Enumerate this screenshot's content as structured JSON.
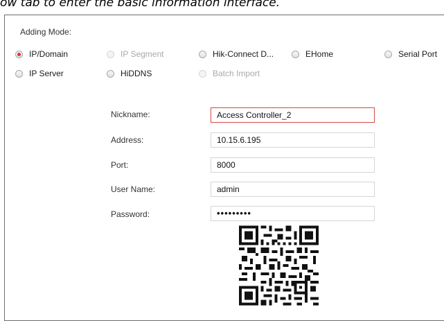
{
  "caption": "ow tab to enter the basic information interface.",
  "adding_mode": {
    "label": "Adding Mode:",
    "options": [
      {
        "label": "IP/Domain",
        "checked": true,
        "disabled": false
      },
      {
        "label": "IP Segment",
        "checked": false,
        "disabled": true
      },
      {
        "label": "Hik-Connect D...",
        "checked": false,
        "disabled": false
      },
      {
        "label": "EHome",
        "checked": false,
        "disabled": false
      },
      {
        "label": "Serial Port",
        "checked": false,
        "disabled": false
      },
      {
        "label": "IP Server",
        "checked": false,
        "disabled": false
      },
      {
        "label": "HiDDNS",
        "checked": false,
        "disabled": false
      },
      {
        "label": "Batch Import",
        "checked": false,
        "disabled": true
      }
    ]
  },
  "form": {
    "nickname": {
      "label": "Nickname:",
      "value": "Access Controller_2"
    },
    "address": {
      "label": "Address:",
      "value": "10.15.6.195"
    },
    "port": {
      "label": "Port:",
      "value": "8000"
    },
    "username": {
      "label": "User Name:",
      "value": "admin"
    },
    "password": {
      "label": "Password:",
      "value": "•••••••••"
    }
  },
  "icons": {
    "qr": "qr-code-icon"
  },
  "colors": {
    "accent": "#e0342b",
    "active_border": "#d9534f"
  }
}
